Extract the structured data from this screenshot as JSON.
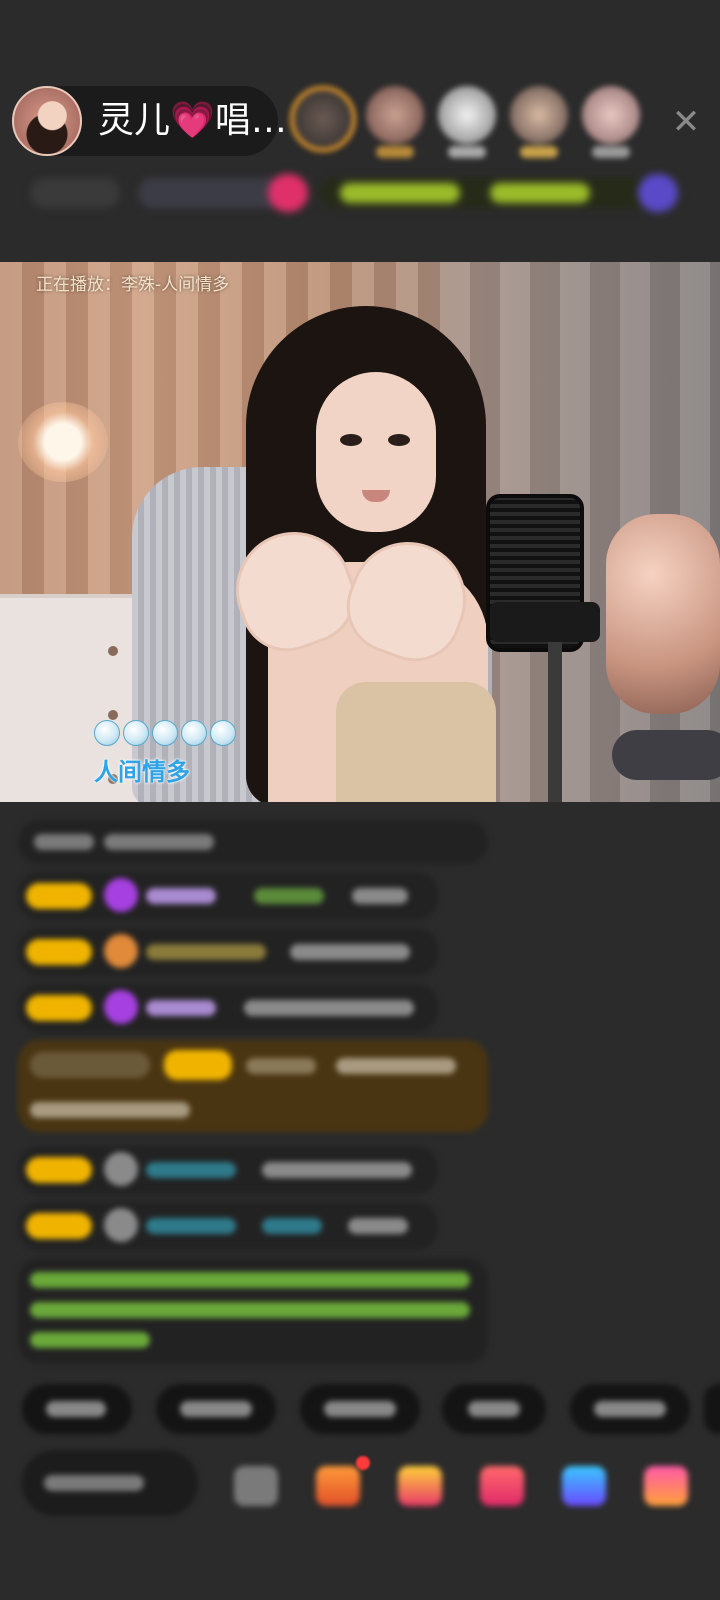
{
  "header": {
    "host_name": "灵儿💗唱…",
    "close_glyph": "✕",
    "viewer_count": 5
  },
  "video": {
    "now_playing": "正在播放：李殊-人间情多",
    "lyric": "人间情多",
    "lyric_dot_count": 5
  },
  "colors": {
    "background": "#2b2b2b",
    "lyric_blue": "#2ea3e6",
    "badge_gold": "#f0b400",
    "chat_green": "#7fc241",
    "highlight_bubble": "#4a3512"
  }
}
